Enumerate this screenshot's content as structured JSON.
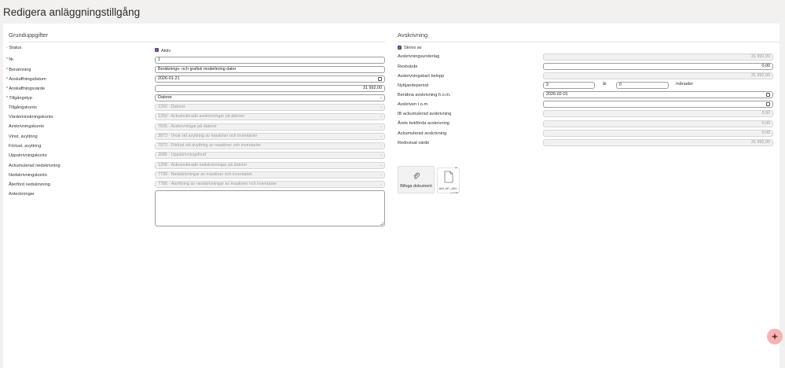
{
  "page": {
    "title": "Redigera anläggningstillgång"
  },
  "left": {
    "section_title": "Grunduppgifter",
    "status": {
      "label": "Status",
      "checkbox_label": "Aktiv",
      "checked": true
    },
    "nr": {
      "label": "Nr.",
      "required": true,
      "value": "1"
    },
    "benamning": {
      "label": "Benämning",
      "required": true,
      "value": "Beräknings- och grafisk modellering dator"
    },
    "anskaffningsdatum": {
      "label": "Anskaffningsdatum",
      "required": true,
      "value": "2026-01-21"
    },
    "anskaffningsvarde": {
      "label": "Anskaffningsvärde",
      "required": true,
      "value": "31 992,00"
    },
    "tillgangstyp": {
      "label": "Tillgångstyp",
      "required": true,
      "value": "Datorer"
    },
    "tillgangskonto": {
      "label": "Tillgångskonto",
      "value": "1250 - Datorer"
    },
    "vardeminskningskonto": {
      "label": "Värdeminskningskonto",
      "value": "1259 - Ackumulerade avskrivningar på datorer"
    },
    "avskrivningskonto": {
      "label": "Avskrivningskonto",
      "value": "7835 - Avskrivningar på datorer"
    },
    "vinst_avyttring": {
      "label": "Vinst, avyttring",
      "value": "3973 - Vinst vid avyttring av maskiner och inventarier"
    },
    "forlust_avyttring": {
      "label": "Förlust, avyttring",
      "value": "7973 - Förlust vid avyttring av maskiner och inventarier"
    },
    "uppskrivningskonto": {
      "label": "Uppskrivningskonto",
      "value": "2085 - Uppskrivningsfond"
    },
    "ack_nedskrivning": {
      "label": "Ackumulerad nedskrivning",
      "value": "1258 - Ackumulerade nedskrivningar på datorer"
    },
    "nedskrivningskonto": {
      "label": "Nedskrivningskonto",
      "value": "7730 - Nedskrivningar av maskiner och inventarier"
    },
    "aterford_nedskrivning": {
      "label": "Återförd nedskrivning",
      "value": "7780 - Återföring av nedskrivningar av maskiner och inventarier"
    },
    "anteckningar": {
      "label": "Anteckningar",
      "value": ""
    }
  },
  "right": {
    "section_title": "Avskrivning",
    "skrivs_av": {
      "label": "Skrivs av",
      "checked": true
    },
    "avskrivningsunderlag": {
      "label": "Avskrivningsunderlag",
      "value": "31 992,00"
    },
    "restvarde": {
      "label": "Restvärde",
      "value": "0,00"
    },
    "avskrivningsbart_belopp": {
      "label": "Avskrivningsbart belopp",
      "value": "31 992,00"
    },
    "nyttjandeperiod": {
      "label": "Nyttjandeperiod",
      "years_value": "3",
      "years_unit": "år",
      "months_value": "0",
      "months_unit": "månader"
    },
    "berakna_fr_om": {
      "label": "Beräkna avskrivning fr.o.m.",
      "value": "2026-02-01"
    },
    "avskriven_t_o_m": {
      "label": "Avskriven t.o.m.",
      "value": ""
    },
    "ib_ack_avskrivning": {
      "label": "IB ackumulerad avskrivning",
      "value": "0,00"
    },
    "arets_bokforda": {
      "label": "Årets bokförda avskrivning",
      "value": "0,00"
    },
    "ack_avskrivning": {
      "label": "Ackumulerad avskrivning",
      "value": "0,00"
    },
    "redovisat_varde": {
      "label": "Redovisat värde",
      "value": "31 992,00"
    }
  },
  "attachments": {
    "button_label": "Bifoga dokument",
    "files": [
      {
        "name": "JAN_HP_JAN...",
        "size": "2,0 MB"
      }
    ]
  },
  "colors": {
    "checkbox": "#5b3f8f",
    "fab": "#f6b3b3",
    "required": "#cc3333"
  },
  "icons": {
    "attach": "paperclip-icon",
    "file": "document-icon",
    "fab": "sparkle-icon",
    "date": "calendar-icon",
    "select": "chevron-down-icon"
  }
}
